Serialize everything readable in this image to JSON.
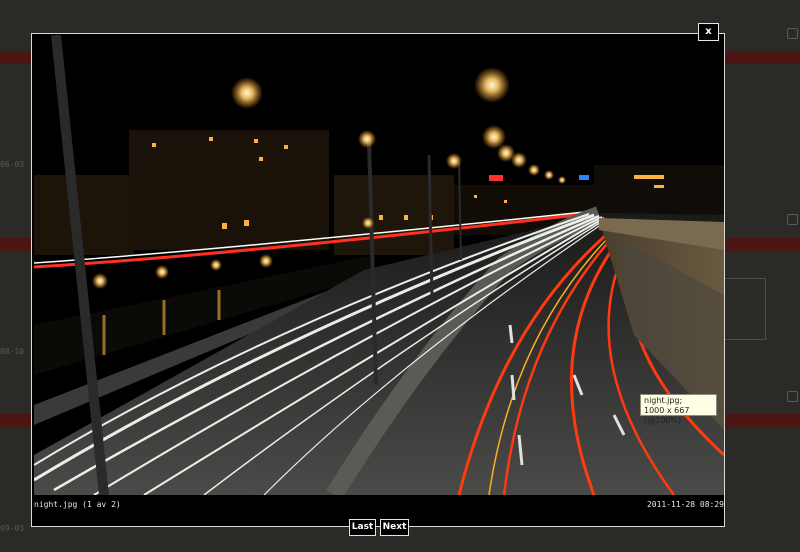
{
  "background": {
    "dates": [
      "06-03",
      "08-10",
      "09-03"
    ]
  },
  "lightbox": {
    "close_label": "x",
    "caption_file": "night.jpg (1 av 2)",
    "caption_date": "2011-11-28 08:29",
    "nav": {
      "last_label": "Last",
      "next_label": "Next"
    },
    "tooltip": {
      "line1": "night.jpg;",
      "line2": "1000 x 667 (@100%)"
    }
  },
  "colors": {
    "overlay": "#2a2a26",
    "stripe": "#4a1512",
    "light_trail_white": "#f4f4f0",
    "light_trail_red": "#ff3a10",
    "tooltip_bg": "#ffffe6"
  },
  "icons": [
    "close-icon",
    "comment-icon"
  ]
}
